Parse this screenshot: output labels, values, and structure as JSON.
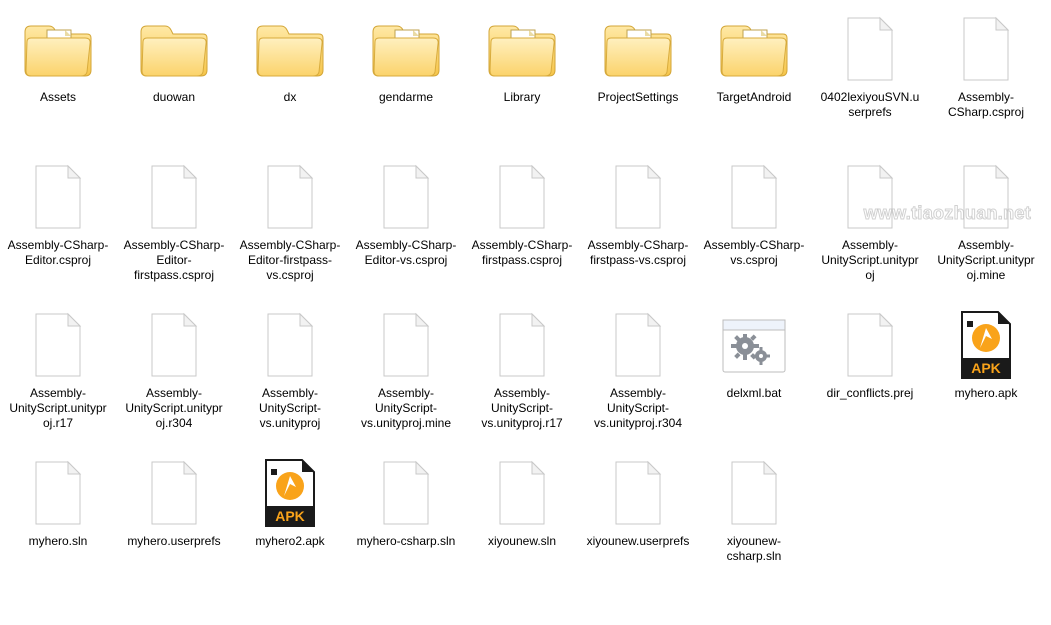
{
  "watermark": "www.tiaozhuan.net",
  "items": [
    {
      "type": "folder-doc",
      "label": "Assets"
    },
    {
      "type": "folder",
      "label": "duowan"
    },
    {
      "type": "folder",
      "label": "dx"
    },
    {
      "type": "folder-doc",
      "label": "gendarme"
    },
    {
      "type": "folder-doc",
      "label": "Library"
    },
    {
      "type": "folder-doc",
      "label": "ProjectSettings"
    },
    {
      "type": "folder-apk",
      "label": "TargetAndroid"
    },
    {
      "type": "file",
      "label": "0402lexiyouSVN.userprefs"
    },
    {
      "type": "file",
      "label": "Assembly-CSharp.csproj"
    },
    {
      "type": "file",
      "label": "Assembly-CSharp-Editor.csproj"
    },
    {
      "type": "file",
      "label": "Assembly-CSharp-Editor-firstpass.csproj"
    },
    {
      "type": "file",
      "label": "Assembly-CSharp-Editor-firstpass-vs.csproj"
    },
    {
      "type": "file",
      "label": "Assembly-CSharp-Editor-vs.csproj"
    },
    {
      "type": "file",
      "label": "Assembly-CSharp-firstpass.csproj"
    },
    {
      "type": "file",
      "label": "Assembly-CSharp-firstpass-vs.csproj"
    },
    {
      "type": "file",
      "label": "Assembly-CSharp-vs.csproj"
    },
    {
      "type": "file",
      "label": "Assembly-UnityScript.unityproj"
    },
    {
      "type": "file",
      "label": "Assembly-UnityScript.unityproj.mine"
    },
    {
      "type": "file",
      "label": "Assembly-UnityScript.unityproj.r17"
    },
    {
      "type": "file",
      "label": "Assembly-UnityScript.unityproj.r304"
    },
    {
      "type": "file",
      "label": "Assembly-UnityScript-vs.unityproj"
    },
    {
      "type": "file",
      "label": "Assembly-UnityScript-vs.unityproj.mine"
    },
    {
      "type": "file",
      "label": "Assembly-UnityScript-vs.unityproj.r17"
    },
    {
      "type": "file",
      "label": "Assembly-UnityScript-vs.unityproj.r304"
    },
    {
      "type": "bat",
      "label": "delxml.bat"
    },
    {
      "type": "file",
      "label": "dir_conflicts.prej"
    },
    {
      "type": "apk",
      "label": "myhero.apk"
    },
    {
      "type": "file",
      "label": "myhero.sln"
    },
    {
      "type": "file",
      "label": "myhero.userprefs"
    },
    {
      "type": "apk",
      "label": "myhero2.apk"
    },
    {
      "type": "file",
      "label": "myhero-csharp.sln"
    },
    {
      "type": "file",
      "label": "xiyounew.sln"
    },
    {
      "type": "file",
      "label": "xiyounew.userprefs"
    },
    {
      "type": "file",
      "label": "xiyounew-csharp.sln"
    }
  ]
}
